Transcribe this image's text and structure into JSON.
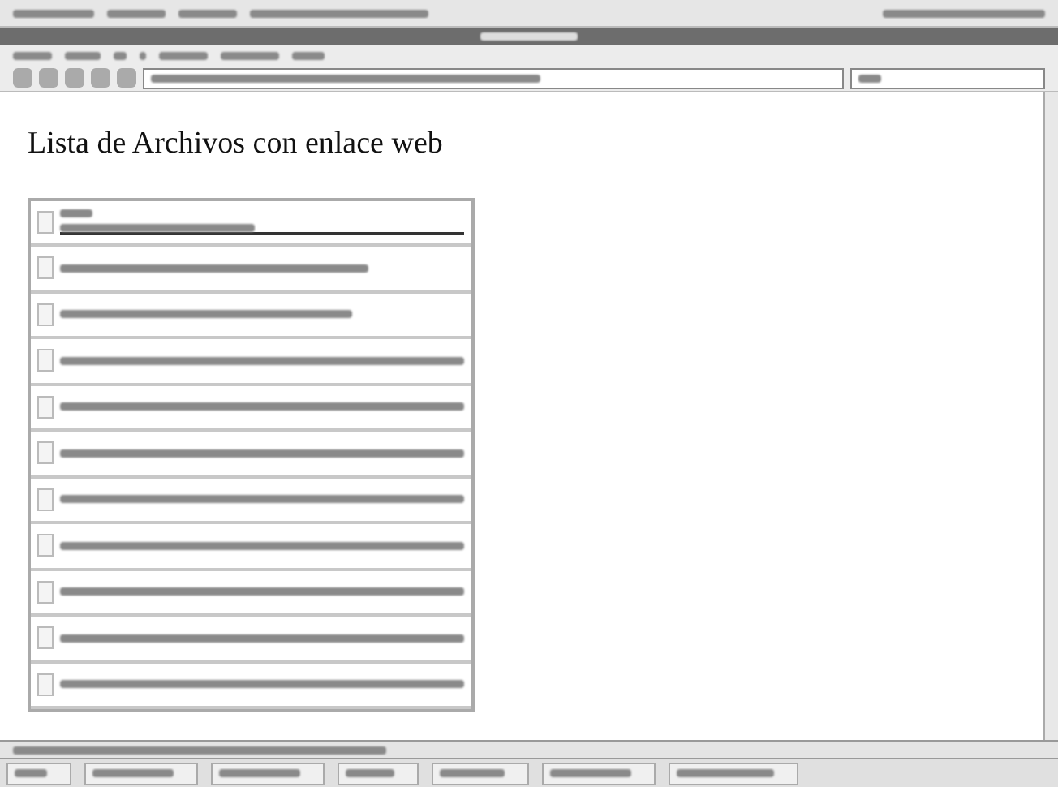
{
  "heading": "Lista de Archivos con enlace web",
  "rows": [
    {
      "kind": "editing",
      "checked": false
    },
    {
      "kind": "item",
      "checked": false
    },
    {
      "kind": "item",
      "checked": false
    },
    {
      "kind": "item",
      "checked": false
    },
    {
      "kind": "item",
      "checked": false
    },
    {
      "kind": "item",
      "checked": false
    },
    {
      "kind": "item",
      "checked": false
    },
    {
      "kind": "item",
      "checked": false
    },
    {
      "kind": "item",
      "checked": false
    },
    {
      "kind": "item",
      "checked": false
    },
    {
      "kind": "item",
      "checked": false
    }
  ]
}
